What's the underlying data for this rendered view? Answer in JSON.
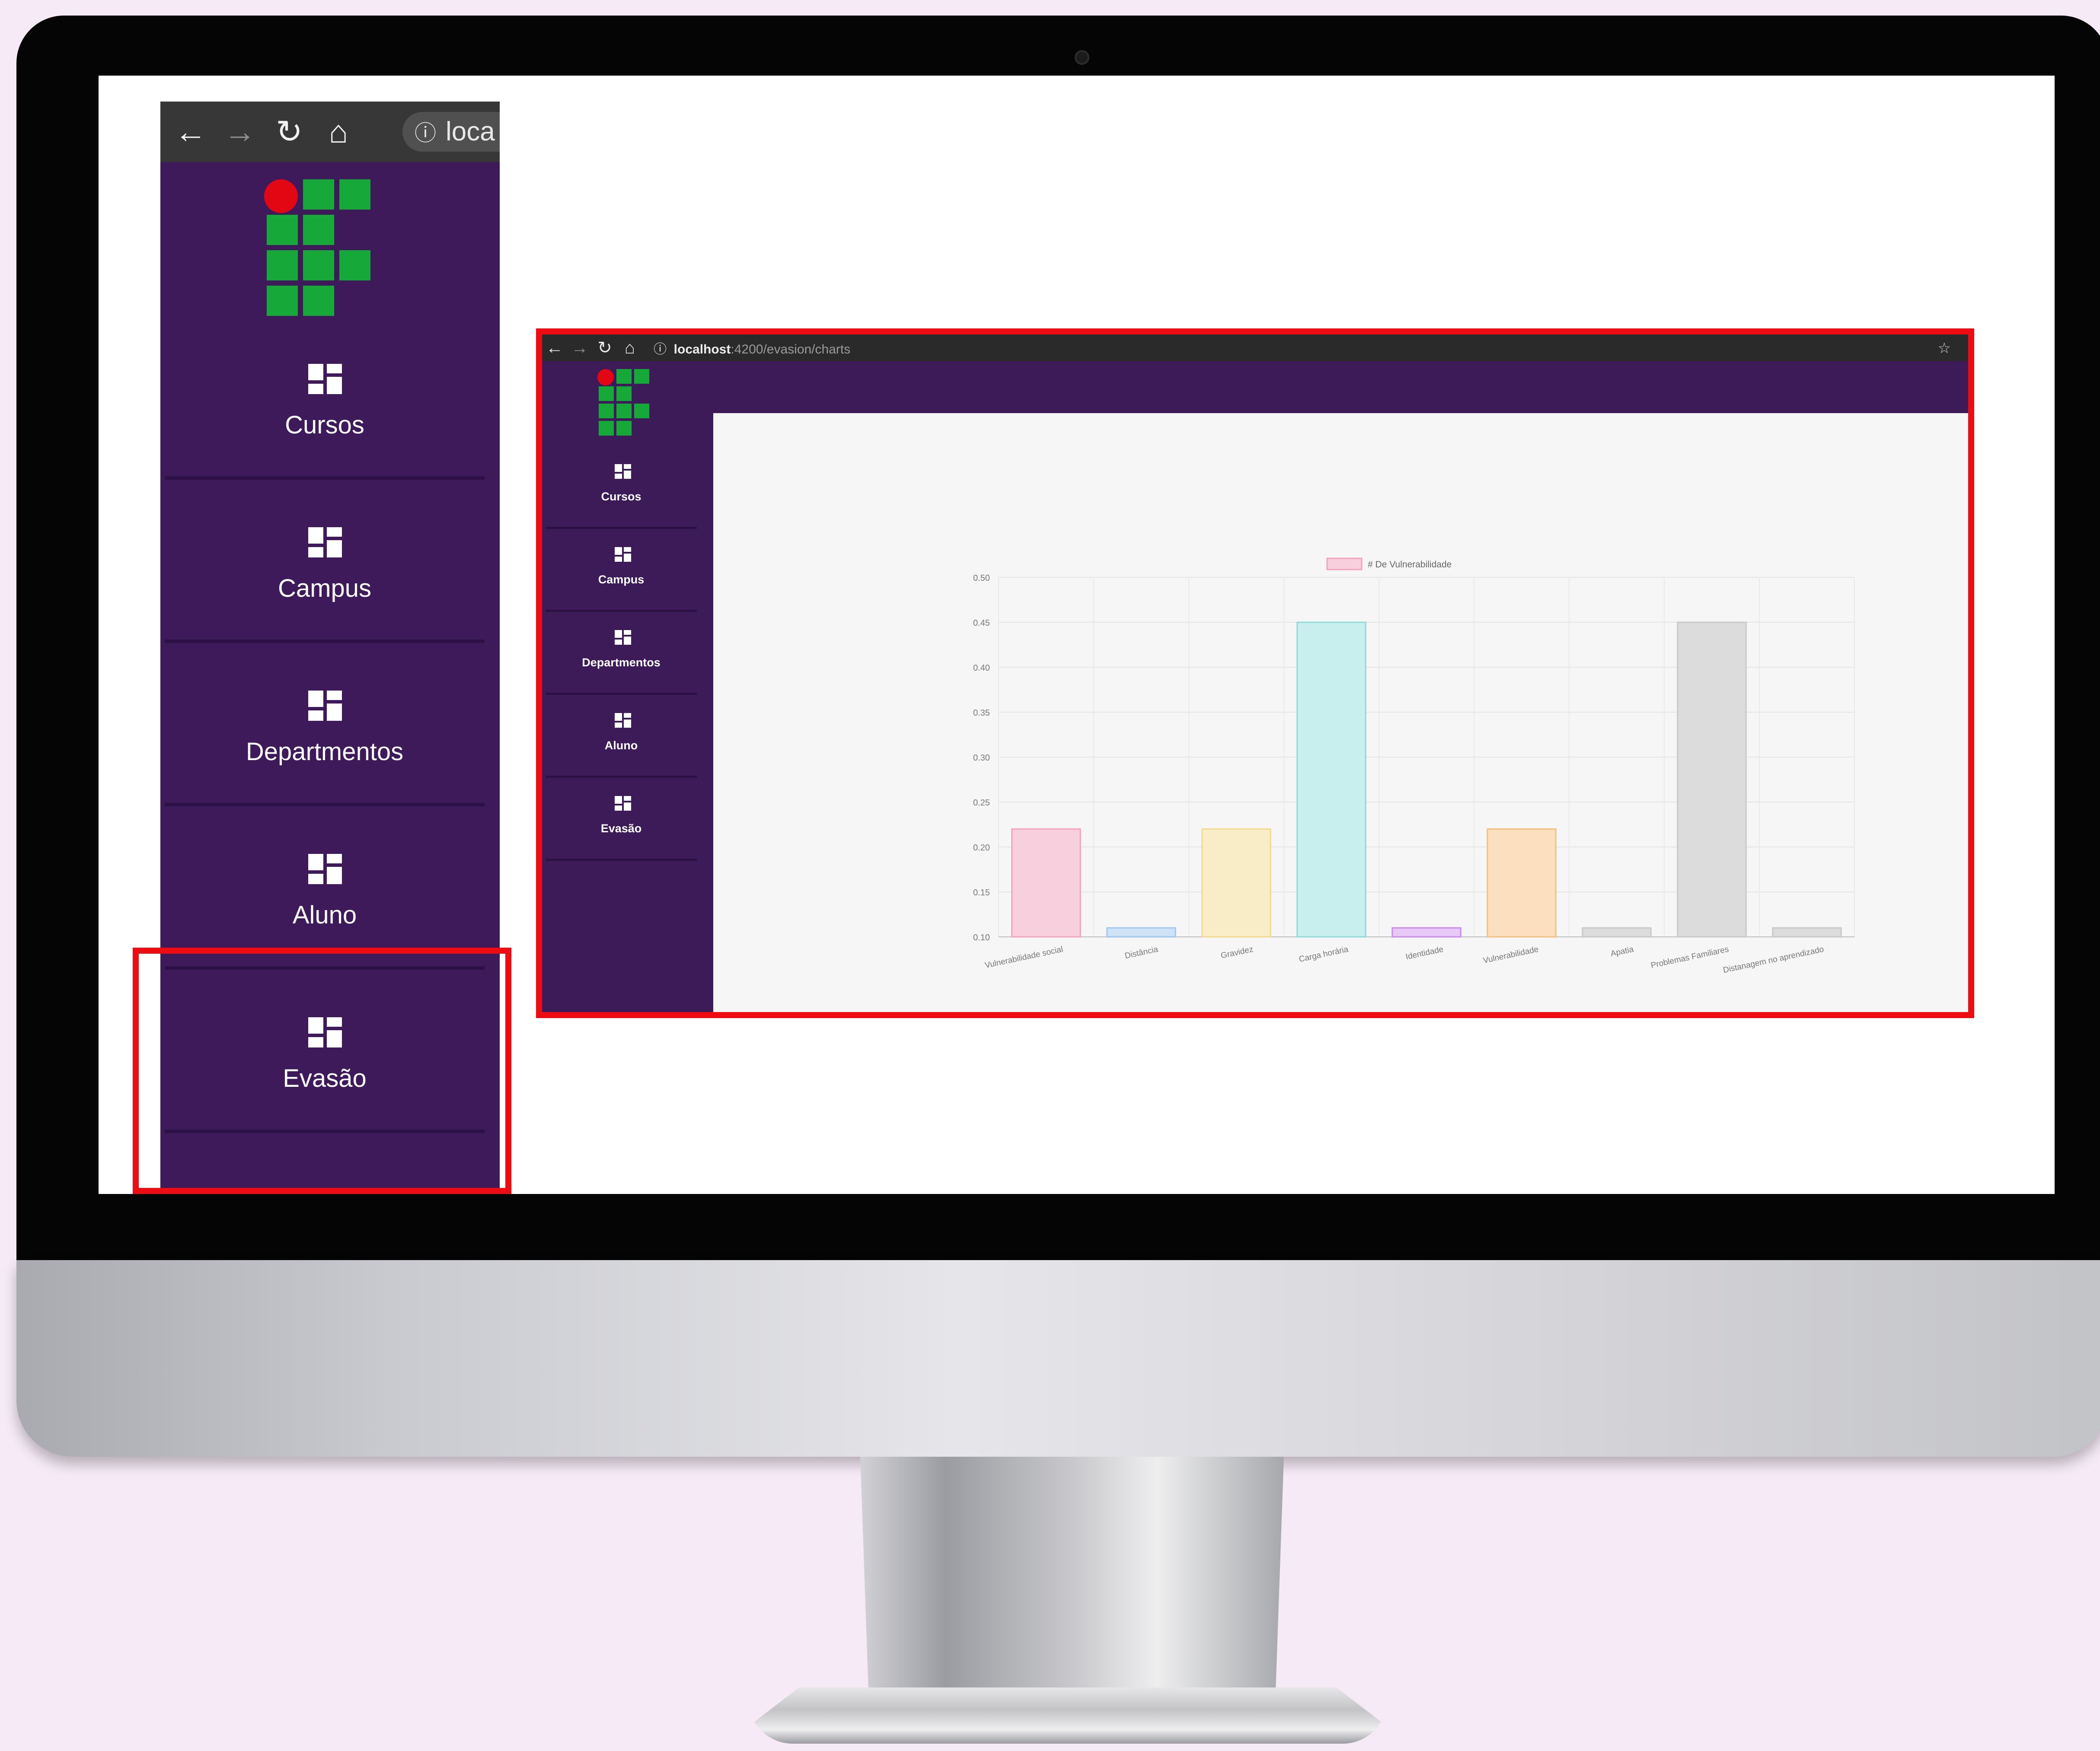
{
  "zoom_sidebar": {
    "url_text": "loca",
    "info_icon": "info-icon",
    "nav_icons": [
      "back-arrow-icon",
      "forward-arrow-icon",
      "reload-icon",
      "home-icon"
    ],
    "items": [
      {
        "label": "Cursos",
        "icon": "dashboard-icon"
      },
      {
        "label": "Campus",
        "icon": "dashboard-icon"
      },
      {
        "label": "Departmentos",
        "icon": "dashboard-icon"
      },
      {
        "label": "Aluno",
        "icon": "dashboard-icon"
      },
      {
        "label": "Evasão",
        "icon": "dashboard-icon"
      }
    ],
    "highlighted_item": "Evasão"
  },
  "app": {
    "url_host": "localhost",
    "url_path": ":4200/evasion/charts",
    "sidebar_items": [
      {
        "label": "Cursos"
      },
      {
        "label": "Campus"
      },
      {
        "label": "Departmentos"
      },
      {
        "label": "Aluno"
      },
      {
        "label": "Evasão"
      }
    ]
  },
  "colors": {
    "sidebar_purple": "#3e1a5b",
    "highlight_red": "#ee0b12",
    "logo_green": "#16a838",
    "logo_red": "#e30613"
  },
  "chart_data": {
    "type": "bar",
    "categories": [
      "Vulnerabilidade social",
      "Distância",
      "Gravidez",
      "Carga horária",
      "Identidade",
      "Vulnerabilidade",
      "Apatia",
      "Problemas Familiares",
      "Distanagem no aprendizado"
    ],
    "series": [
      {
        "name": "# De Vulnerabilidade",
        "values": [
          0.22,
          0.11,
          0.22,
          0.45,
          0.11,
          0.22,
          0.11,
          0.45,
          0.11
        ]
      }
    ],
    "colors": [
      "#f7cfdd",
      "#cfe3f7",
      "#f9edc8",
      "#c8eeee",
      "#e7c8f6",
      "#fbdfbf",
      "#dcdcdc",
      "#dcdcdc",
      "#dcdcdc"
    ],
    "border_colors": [
      "#f2a2bb",
      "#9fc6ec",
      "#f2d98c",
      "#8fd9d9",
      "#c98aeb",
      "#f6bd7c",
      "#c9c9c9",
      "#c9c9c9",
      "#c9c9c9"
    ],
    "yticks": [
      "0.10",
      "0.15",
      "0.20",
      "0.25",
      "0.30",
      "0.35",
      "0.40",
      "0.45",
      "0.50"
    ],
    "ylim": [
      0.1,
      0.5
    ],
    "grid": true,
    "legend": "top"
  }
}
